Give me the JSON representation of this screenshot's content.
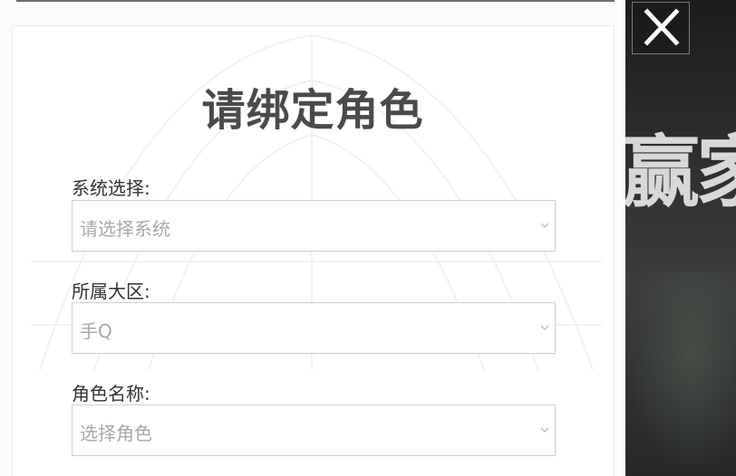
{
  "dialog": {
    "title": "请绑定角色",
    "fields": [
      {
        "label": "系统选择:",
        "value": "请选择系统"
      },
      {
        "label": "所属大区:",
        "value": "手Q"
      },
      {
        "label": "角色名称:",
        "value": "选择角色"
      }
    ]
  },
  "background": {
    "banner_text": "赢家"
  },
  "icons": {
    "close": "close-icon",
    "select": "chevron-down-icon"
  },
  "colors": {
    "title": "#4a4a4a",
    "placeholder": "#a9a9a9",
    "border": "#cfcfcf"
  }
}
